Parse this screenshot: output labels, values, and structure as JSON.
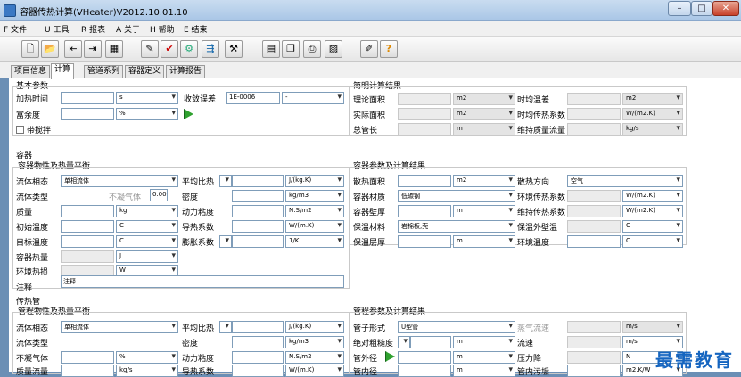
{
  "window": {
    "title": "容器传热计算(VHeater)V2012.10.01.10",
    "minimize": "–",
    "maximize": "□",
    "close": "✕"
  },
  "menu": [
    "F 文件",
    "U 工具",
    "R 报表",
    "A 关于",
    "H 帮助",
    "E 结束"
  ],
  "toolbar_icons": [
    "new-file-icon",
    "open-folder-icon",
    "import-icon",
    "export-icon",
    "table-icon",
    "edit-icon",
    "check-icon",
    "pipe-icon",
    "flow-icon",
    "tool-icon",
    "page-icon",
    "copy-pages-icon",
    "print-icon",
    "chart-icon",
    "pen-icon",
    "help-icon"
  ],
  "toolbar_glyphs": [
    "🗋",
    "📂",
    "⇤",
    "⇥",
    "▦",
    "✎",
    "✔",
    "⚙",
    "⇶",
    "⚒",
    "▤",
    "❐",
    "⎙",
    "▨",
    "✐",
    "?"
  ],
  "tabs": [
    "项目信息",
    "计算",
    "管道系列",
    "容器定义",
    "计算报告"
  ],
  "basic": {
    "title": "基本参数",
    "heat_time": "加热时间",
    "heat_time_unit": "s",
    "margin": "富余度",
    "margin_unit": "%",
    "stir": "带搅拌",
    "converge": "收敛误差",
    "converge_value": "1E-0006",
    "converge_sel": "-"
  },
  "summary": {
    "title": "简明计算结果",
    "theory_area": "理论面积",
    "actual_area": "实际面积",
    "total_len": "总管长",
    "m2": "m2",
    "m": "m",
    "mean_temp": "时均温差",
    "mean_temp_unit": "m2",
    "mean_coef": "时均传热系数",
    "mean_coef_unit": "W/(m2.K)",
    "keep_flow": "维持质量流量",
    "keep_flow_unit": "kg/s"
  },
  "vessel": {
    "title": "容器",
    "phys_title": "容器物性及热量平衡",
    "phase": "流体相态",
    "phase_value": "单相流体",
    "fluid_type": "流体类型",
    "noncond": "不凝气体",
    "noncond_val": "0.00",
    "mass": "质量",
    "mass_unit": "kg",
    "init_temp": "初始温度",
    "target_temp": "目标温度",
    "temp_unit": "C",
    "vessel_heat": "容器热量",
    "heat_unit": "J",
    "env_loss": "环境热损",
    "loss_unit": "W",
    "note": "注释",
    "note_value": "注释",
    "cp": "平均比热",
    "cp_unit": "J/(kg.K)",
    "density": "密度",
    "density_unit": "kg/m3",
    "visc": "动力粘度",
    "visc_unit": "N.S/m2",
    "cond": "导热系数",
    "cond_unit": "W/(m.K)",
    "expan": "膨胀系数",
    "expan_unit": "1/K",
    "param_title": "容器参数及计算结果",
    "heat_area": "散热面积",
    "area_unit": "m2",
    "material": "容器材质",
    "material_value": "低碳钢",
    "wall": "容器壁厚",
    "wall_unit": "m",
    "insul": "保温材料",
    "insul_value": "岩棉板,壳",
    "insul_thk": "保温层厚",
    "thk_unit": "m",
    "dir": "散热方向",
    "dir_value": "空气",
    "env_coef": "环境传热系数",
    "env_coef_unit": "W/(m2.K)",
    "keep_coef": "维持传热系数",
    "keep_coef_unit": "W/(m2.K)",
    "outer_temp": "保温外壁温",
    "outer_unit": "C",
    "env_temp": "环境温度",
    "env_unit": "C"
  },
  "pipe": {
    "title": "传热管",
    "phys_title": "管程物性及热量平衡",
    "phase": "流体相态",
    "phase_value": "单相流体",
    "fluid_type": "流体类型",
    "noncond": "不凝气体",
    "noncond_unit": "%",
    "mass_flow": "质量流量",
    "mass_flow_unit": "kg/s",
    "cp": "平均比热",
    "cp_unit": "J/(kg.K)",
    "density": "密度",
    "density_unit": "kg/m3",
    "visc": "动力粘度",
    "visc_unit": "N.S/m2",
    "cond": "导热系数",
    "cond_unit": "W/(m.K)",
    "param_title": "管程参数及计算结果",
    "form": "管子形式",
    "form_value": "U型管",
    "rough": "绝对粗糙度",
    "od": "管外径",
    "id": "管内径",
    "m": "m",
    "steam": "蒸气流速",
    "steam_unit": "m/s",
    "velocity": "流速",
    "velocity_unit": "m/s",
    "dp": "压力降",
    "dp_unit": "N",
    "foul": "管内污垢",
    "foul_unit": "m2.K/W"
  },
  "watermark": "最需教育"
}
